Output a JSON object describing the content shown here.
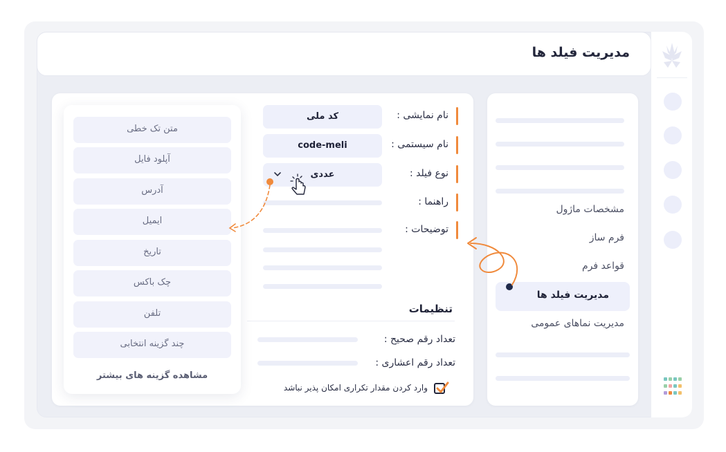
{
  "header": {
    "title": "مدیریت فیلد ها"
  },
  "sidebar": {
    "items": [
      {
        "label": "مشخصات ماژول"
      },
      {
        "label": "فرم ساز"
      },
      {
        "label": "قواعد فرم"
      },
      {
        "label": "مدیریت فیلد ها"
      },
      {
        "label": "مدیریت نماهای عمومی"
      }
    ]
  },
  "form": {
    "display_name": {
      "label": "نام نمایشی :",
      "value": "کد ملی"
    },
    "system_name": {
      "label": "نام سیستمی :",
      "value": "code-meli"
    },
    "field_type": {
      "label": "نوع فیلد :",
      "value": "عددی"
    },
    "guide": {
      "label": "راهنما :"
    },
    "description": {
      "label": "توضیحات :"
    }
  },
  "settings": {
    "title": "تنظیمات",
    "integer_digits": {
      "label": "تعداد رقم صحیح :"
    },
    "decimal_digits": {
      "label": "تعداد رقم اعشاری :"
    },
    "no_duplicate": {
      "label": "وارد کردن مقدار تکراری امکان پذیر نباشد",
      "checked": true
    }
  },
  "dropdown": {
    "options": [
      {
        "label": "متن تک خطی"
      },
      {
        "label": "آپلود فایل"
      },
      {
        "label": "آدرس"
      },
      {
        "label": "ایمیل"
      },
      {
        "label": "تاریخ"
      },
      {
        "label": "چک باکس"
      },
      {
        "label": "تلفن"
      },
      {
        "label": "چند گزینه انتخابی"
      }
    ],
    "more_label": "مشاهده گزینه های بیشتر"
  },
  "icons": {
    "logo": "leaf-logo-icon",
    "apps": "apps-grid-icon",
    "chevron": "chevron-down-icon",
    "cursor": "hand-pointer-icon",
    "check": "checkmark-icon"
  },
  "colors": {
    "accent": "#f08a3c",
    "dark": "#1f2a4a",
    "option_bg": "#f1f2fb"
  }
}
